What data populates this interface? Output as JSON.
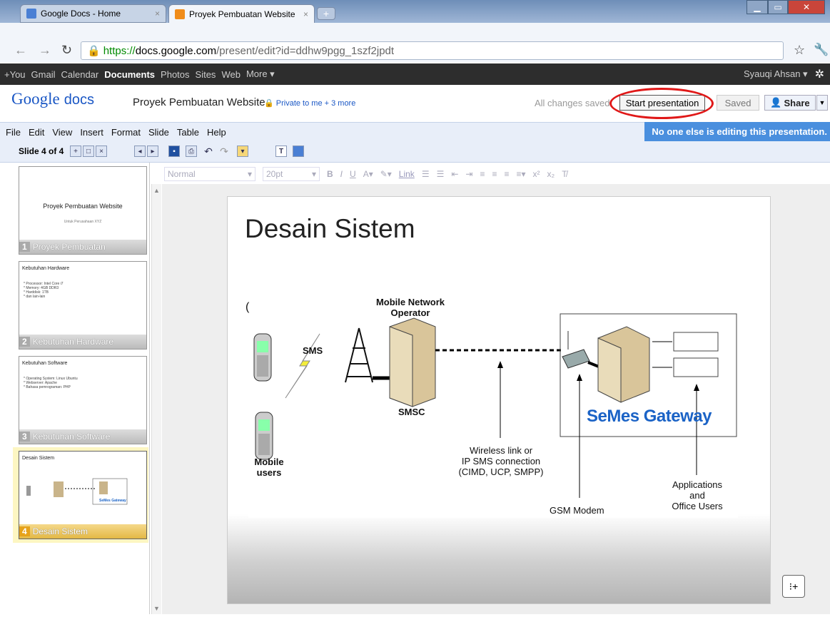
{
  "browser": {
    "tabs": [
      {
        "title": "Google Docs - Home"
      },
      {
        "title": "Proyek Pembuatan Website"
      }
    ],
    "url_scheme": "https://",
    "url_host": "docs.google.com",
    "url_path": "/present/edit?id=ddhw9pgg_1szf2jpdt"
  },
  "gbar": {
    "links": [
      "+You",
      "Gmail",
      "Calendar",
      "Documents",
      "Photos",
      "Sites",
      "Web",
      "More ▾"
    ],
    "active": "Documents",
    "user": "Syauqi Ahsan ▾"
  },
  "header": {
    "logo_google": "Google",
    "logo_docs": "docs",
    "doc_title": "Proyek Pembuatan Website",
    "privacy": "Private to me + 3 more",
    "save_status": "All changes saved",
    "start_presentation": "Start presentation",
    "saved": "Saved",
    "share": "Share"
  },
  "menu": [
    "File",
    "Edit",
    "View",
    "Insert",
    "Format",
    "Slide",
    "Table",
    "Help"
  ],
  "editing_notice": "No one else is editing this presentation.",
  "toolbar": {
    "slide_count": "Slide 4 of 4",
    "style": "Normal",
    "size": "20pt",
    "link": "Link"
  },
  "slides": [
    {
      "num": "1",
      "label": "Proyek Pembuatan",
      "title": "Proyek Pembuatan Website",
      "subtitle": "Untuk Perusahaan XYZ"
    },
    {
      "num": "2",
      "label": "Kebutuhan Hardware",
      "title": "Kebutuhan Hardware",
      "bullets": "* Processor: Intel Core i7\n* Memory: 4GB DDR3\n* Harddisk: 1TB\n* dan lain-lain"
    },
    {
      "num": "3",
      "label": "Kebutuhan Software",
      "title": "Kebutuhan Software",
      "bullets": "* Operating System: Linux Ubuntu\n* Webserver: Apache\n* Bahasa pemrograman: PHP"
    },
    {
      "num": "4",
      "label": "Desain Sistem",
      "title": "Desain Sistem"
    }
  ],
  "current_slide": {
    "title": "Desain Sistem",
    "diagram": {
      "mno": "Mobile Network\nOperator",
      "sms": "SMS",
      "smsc": "SMSC",
      "mobile_users": "Mobile\nusers",
      "wireless": "Wireless link or\nIP SMS connection\n(CIMD, UCP, SMPP)",
      "gateway": "SeMes Gateway",
      "gsm_modem": "GSM Modem",
      "apps": "Applications\nand\nOffice Users",
      "paren": "("
    }
  }
}
